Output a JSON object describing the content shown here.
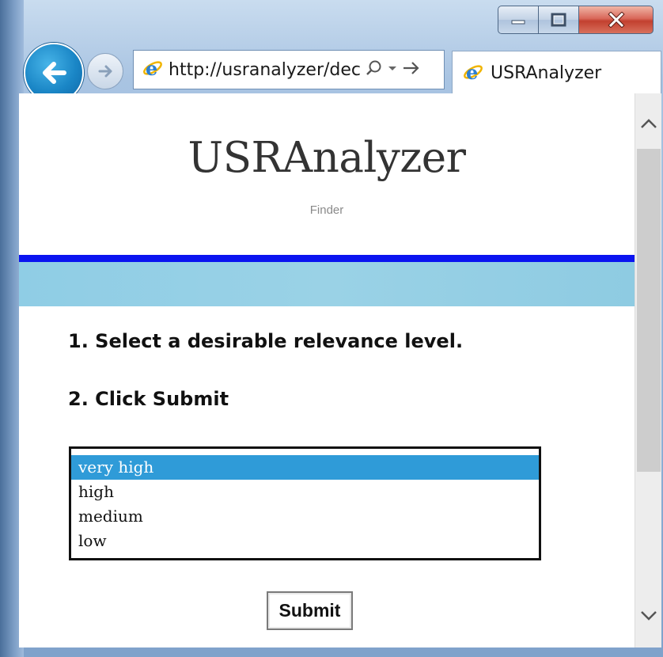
{
  "window": {
    "minimize_icon": "minimize-icon",
    "maximize_icon": "maximize-icon",
    "close_icon": "close-icon"
  },
  "nav": {
    "back_icon": "arrow-left-icon",
    "forward_icon": "arrow-right-icon",
    "address_url": "http://usranalyzer/dec",
    "search_icon": "search-icon",
    "dropdown_icon": "dropdown-icon",
    "go_icon": "go-arrow-icon",
    "tab_title": "USRAnalyzer"
  },
  "page": {
    "title": "USRAnalyzer",
    "subtitle": "Finder",
    "step1": "1. Select a desirable relevance level.",
    "step2": "2. Click Submit",
    "options": [
      "very high",
      "high",
      "medium",
      "low"
    ],
    "selected_option": "very high",
    "submit_label": "Submit"
  },
  "colors": {
    "accent_line": "#0a14f0",
    "banner": "#95d0e5",
    "selection": "#2f9bd8",
    "back_button": "#1a86c6"
  }
}
